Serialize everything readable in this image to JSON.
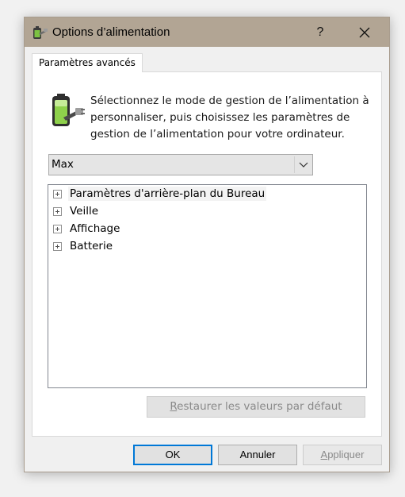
{
  "window": {
    "title": "Options d’alimentation",
    "help_label": "?",
    "close_label": "✕"
  },
  "tab": {
    "label": "Paramètres avancés"
  },
  "description": "Sélectionnez le mode de gestion de l’alimentation à personnaliser, puis choisissez les paramètres de gestion de l’alimentation pour votre ordinateur.",
  "plan_select": {
    "value": "Max"
  },
  "tree": {
    "items": [
      {
        "label": "Paramètres d'arrière-plan du Bureau",
        "selected": true
      },
      {
        "label": "Veille"
      },
      {
        "label": "Affichage"
      },
      {
        "label": "Batterie"
      }
    ]
  },
  "restore_button": {
    "mnemonic": "R",
    "rest": "estaurer les valeurs par défaut"
  },
  "buttons": {
    "ok": "OK",
    "cancel": "Annuler",
    "apply_mnemonic": "A",
    "apply_rest": "ppliquer"
  },
  "colors": {
    "titlebar": "#b2a594",
    "ok_focus": "#0078d7",
    "disabled_text": "#8a8a8a"
  }
}
